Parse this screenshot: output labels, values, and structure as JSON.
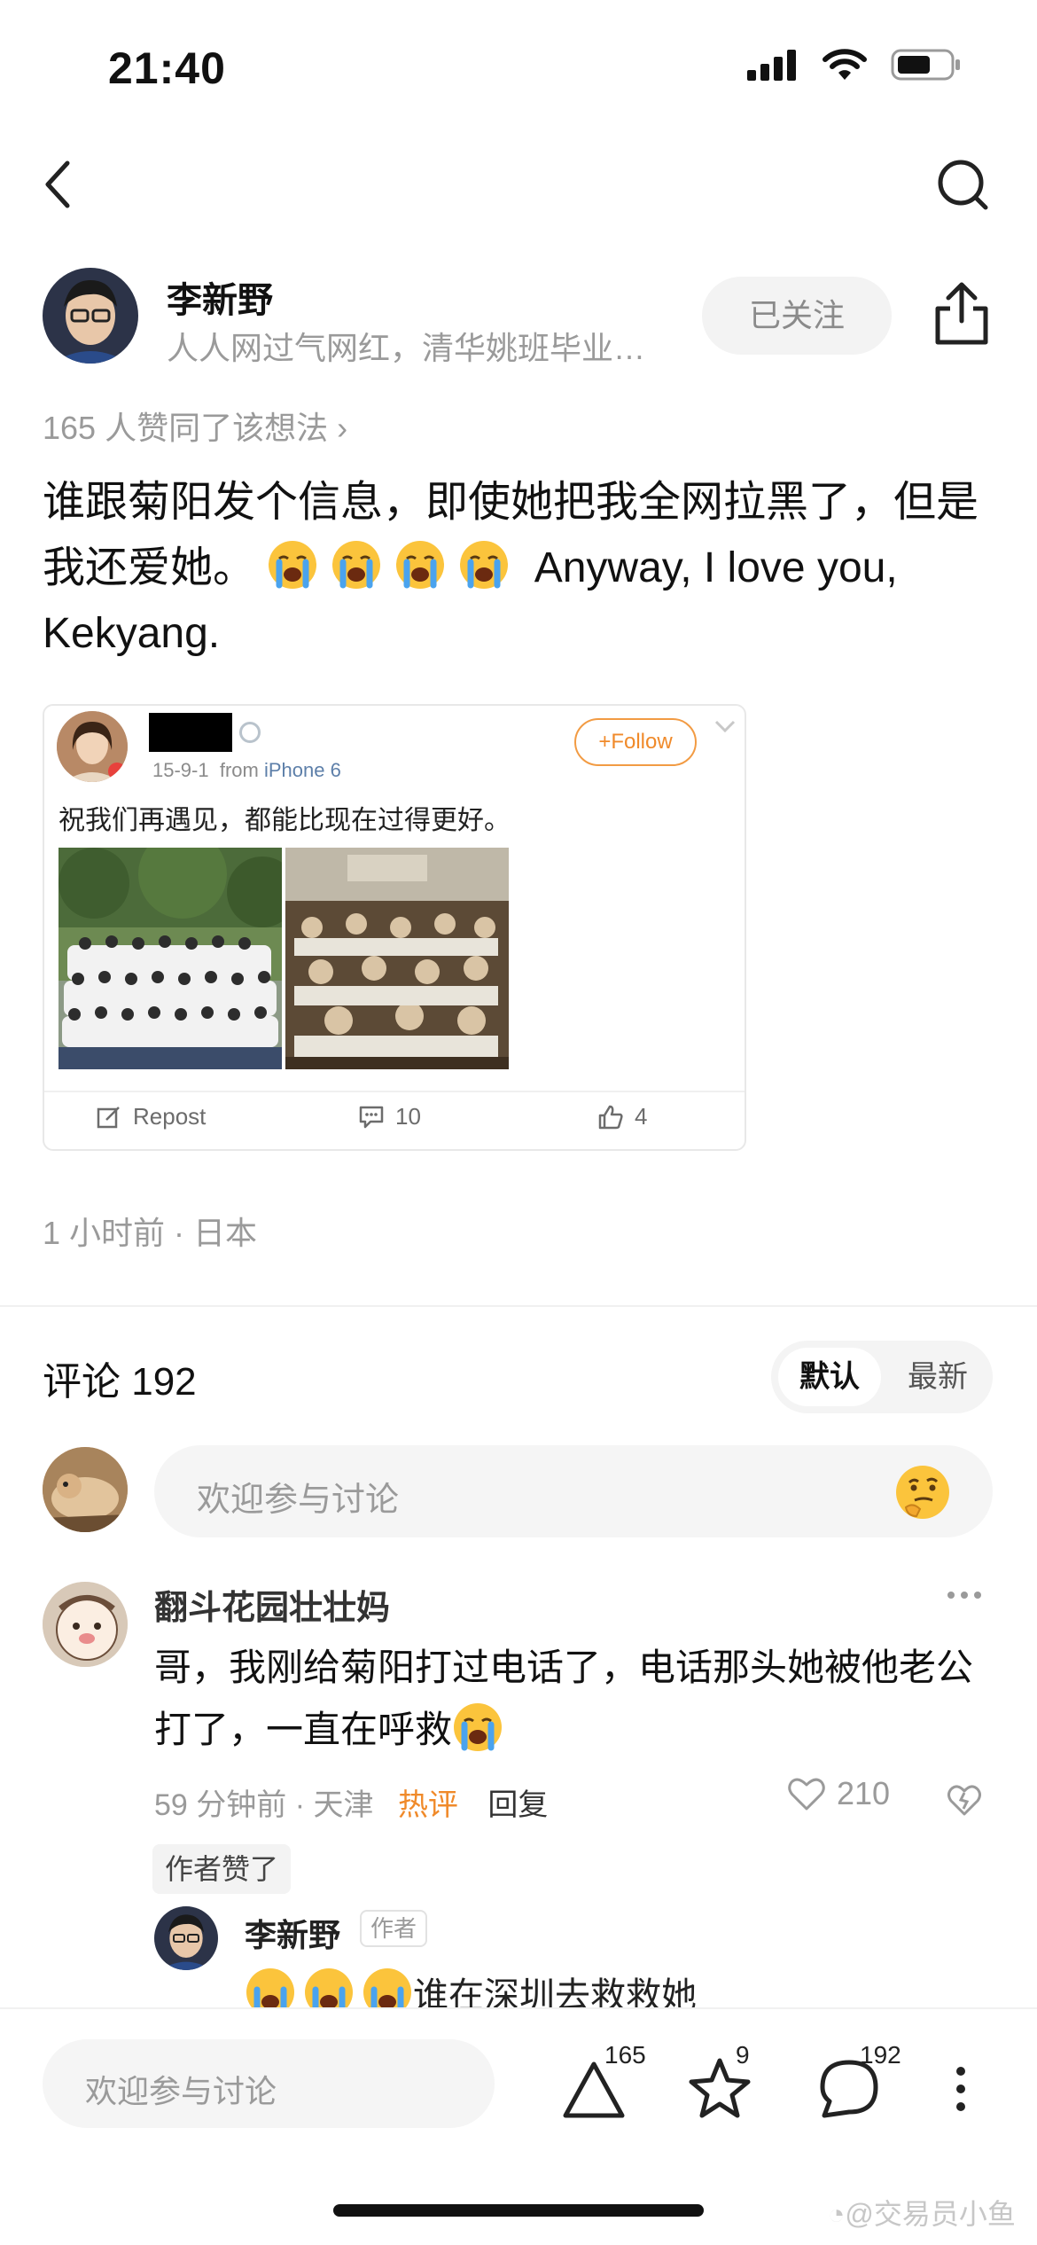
{
  "status_bar": {
    "time": "21:40"
  },
  "author": {
    "name": "李新野",
    "description": "人人网过气网红，清华姚班毕业…",
    "follow_label": "已关注"
  },
  "agree_text": "165 人赞同了该想法 ›",
  "post": {
    "text_part1": "谁跟菊阳发个信息，即使她把我全网拉黑了，但是我还爱她。",
    "emoji_name": "crying-face",
    "text_part2": "Anyway, I love you, Kekyang."
  },
  "embed": {
    "date": "15-9-1",
    "from_prefix": "from",
    "device": "iPhone 6",
    "follow_label": "+Follow",
    "text": "祝我们再遇见，都能比现在过得更好。",
    "repost_label": "Repost",
    "comment_count": "10",
    "like_count": "4"
  },
  "time_location": "1 小时前 · 日本",
  "comments_section": {
    "title": "评论 192",
    "sort_default": "默认",
    "sort_latest": "最新",
    "input_placeholder": "欢迎参与讨论"
  },
  "comment": {
    "name": "翻斗花园壮壮妈",
    "text": "哥，我刚给菊阳打过电话了，电话那头她被他老公打了，一直在呼救",
    "time_loc": "59 分钟前 · 天津",
    "hot_label": "热评",
    "reply_label": "回复",
    "likes": "210",
    "author_liked": "作者赞了"
  },
  "sub_reply": {
    "name": "李新野",
    "tag": "作者",
    "text": "谁在深圳去救救她"
  },
  "bottom_bar": {
    "placeholder": "欢迎参与讨论",
    "agree_count": "165",
    "star_count": "9",
    "comment_count": "192"
  },
  "watermark": "@交易员小鱼",
  "colors": {
    "accent": "#f08a2a",
    "link": "#5d7fa9",
    "muted": "#9a9a9a"
  }
}
